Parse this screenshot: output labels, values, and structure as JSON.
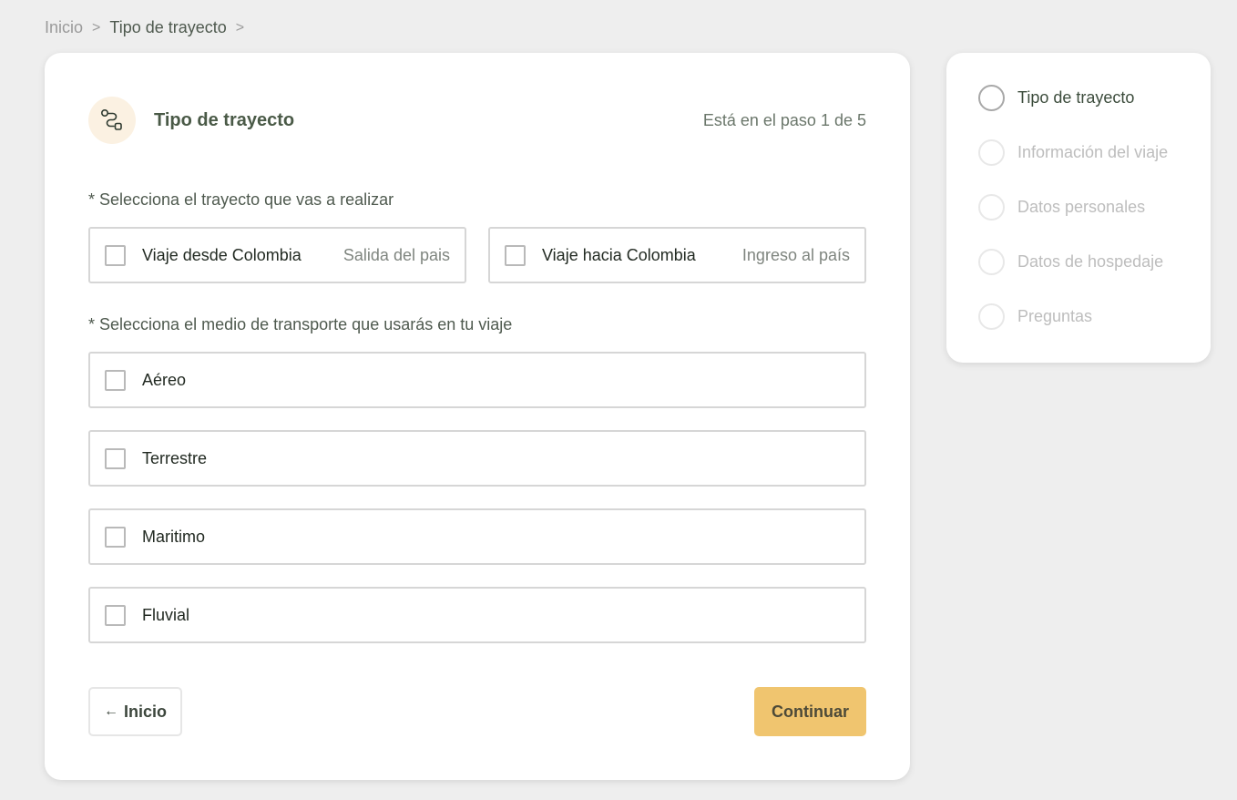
{
  "breadcrumb": {
    "home": "Inicio",
    "current": "Tipo de trayecto",
    "separator": ">"
  },
  "header": {
    "icon": "route-icon",
    "title": "Tipo de trayecto",
    "step_indicator": "Está en el paso 1 de 5"
  },
  "trip": {
    "label": "* Selecciona el trayecto que vas a realizar",
    "options": [
      {
        "label": "Viaje desde Colombia",
        "description": "Salida del pais",
        "checked": false
      },
      {
        "label": "Viaje hacia Colombia",
        "description": "Ingreso al país",
        "checked": false
      }
    ]
  },
  "transport": {
    "label": "* Selecciona el medio de transporte que usarás en tu viaje",
    "options": [
      {
        "label": "Aéreo",
        "checked": false
      },
      {
        "label": "Terrestre",
        "checked": false
      },
      {
        "label": "Maritimo",
        "checked": false
      },
      {
        "label": "Fluvial",
        "checked": false
      }
    ]
  },
  "actions": {
    "back_arrow": "←",
    "back_label": "Inicio",
    "continue_label": "Continuar"
  },
  "steps": [
    {
      "label": "Tipo de trayecto",
      "active": true
    },
    {
      "label": "Información del viaje",
      "active": false
    },
    {
      "label": "Datos personales",
      "active": false
    },
    {
      "label": "Datos de hospedaje",
      "active": false
    },
    {
      "label": "Preguntas",
      "active": false
    }
  ],
  "colors": {
    "background": "#eeeeee",
    "accent": "#f0c56f",
    "icon_bg": "#fbf1e2",
    "title": "#4a5a47"
  }
}
